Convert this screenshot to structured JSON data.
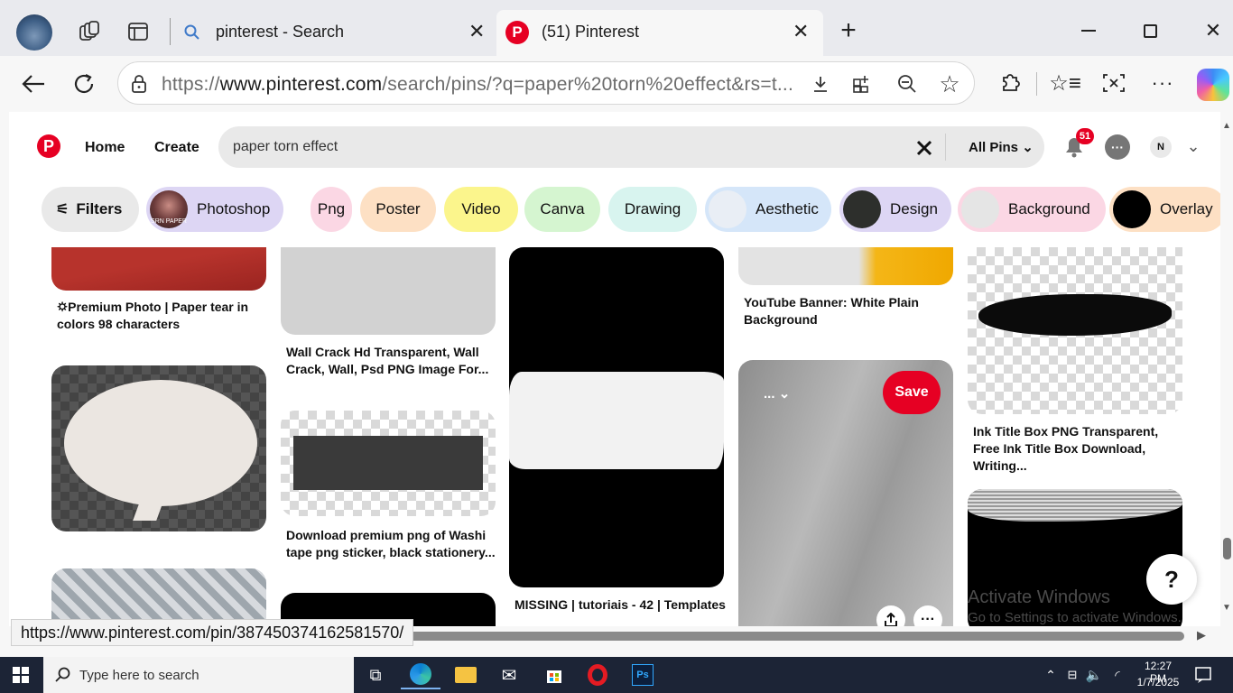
{
  "browser": {
    "tabs": [
      {
        "title": "pinterest - Search",
        "active": false
      },
      {
        "title": "(51) Pinterest",
        "active": true
      }
    ],
    "url_prefix": "https://",
    "url_domain": "www.pinterest.com",
    "url_path": "/search/pins/?q=paper%20torn%20effect&rs=t...",
    "status_url": "https://www.pinterest.com/pin/387450374162581570/"
  },
  "pinterest": {
    "nav": {
      "home": "Home",
      "create": "Create"
    },
    "search_query": "paper torn effect",
    "filter_label": "All Pins",
    "notification_count": "51",
    "avatar_initial": "N",
    "filters_button": "Filters",
    "chips": [
      {
        "label": "Photoshop",
        "bg": "#ddd6f4"
      },
      {
        "label": "Png",
        "bg": "#fbd7e4"
      },
      {
        "label": "Poster",
        "bg": "#fde0c4"
      },
      {
        "label": "Video",
        "bg": "#fbf58c"
      },
      {
        "label": "Canva",
        "bg": "#d5f5d0"
      },
      {
        "label": "Drawing",
        "bg": "#d8f4ef"
      },
      {
        "label": "Aesthetic",
        "bg": "#d5e6f9"
      },
      {
        "label": "Design",
        "bg": "#ddd6f4"
      },
      {
        "label": "Background",
        "bg": "#fbd7e4"
      },
      {
        "label": "Overlay",
        "bg": "#fde0c4"
      }
    ],
    "chip_thumb_text": "SRN PAPER",
    "pins": {
      "c1_cap1": "🌣Premium Photo | Paper tear in colors 98 characters",
      "c2_cap1": "Wall Crack Hd Transparent, Wall Crack, Wall, Psd PNG Image For...",
      "c2_cap2": "Download premium png of Washi tape png sticker, black stationery...",
      "c3_cap1": "MISSING | tutoriais - 42 | Templates",
      "c4_cap1": "YouTube Banner: White Plain Background",
      "c4_board": "...",
      "c4_save": "Save",
      "c5_cap1": "Ink Title Box PNG Transparent, Free Ink Title Box Download, Writing..."
    },
    "help": "?"
  },
  "watermark": {
    "line1": "Activate Windows",
    "line2": "Go to Settings to activate Windows."
  },
  "taskbar": {
    "search_placeholder": "Type here to search",
    "time": "12:27 PM",
    "date": "1/7/2025"
  }
}
